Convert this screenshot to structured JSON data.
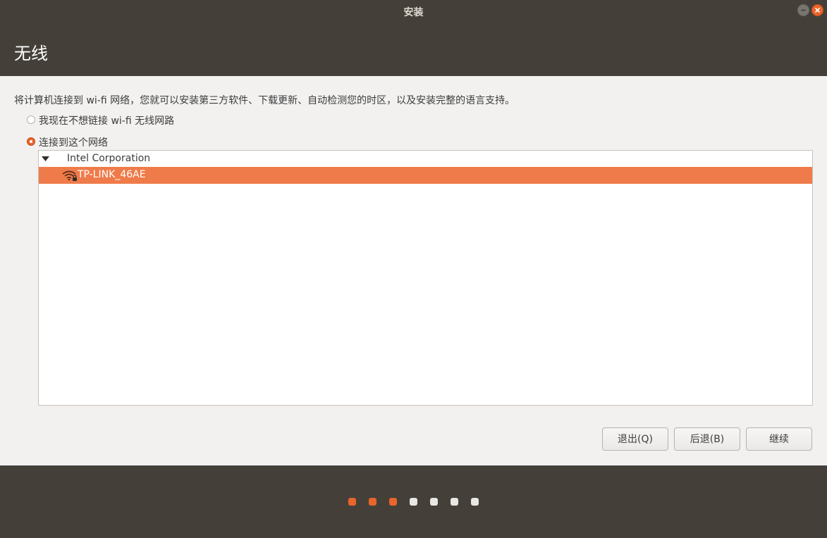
{
  "window": {
    "title": "安装"
  },
  "header": {
    "title": "无线"
  },
  "content": {
    "description": "将计算机连接到 wi-fi 网络，您就可以安装第三方软件、下载更新、自动检测您的时区，以及安装完整的语言支持。",
    "options": [
      {
        "label": "我现在不想链接 wi-fi 无线网路",
        "selected": false
      },
      {
        "label": "连接到这个网络",
        "selected": true
      }
    ],
    "network_list": {
      "device": "Intel Corporation",
      "networks": [
        {
          "ssid": "TP-LINK_46AE",
          "selected": true,
          "secured": true,
          "icon": "wifi-locked-icon"
        }
      ]
    }
  },
  "buttons": {
    "quit": "退出(Q)",
    "back": "后退(B)",
    "continue": "继续"
  },
  "progress": {
    "total_steps": 7,
    "completed_steps": 3
  },
  "colors": {
    "accent": "#e9652b",
    "selection": "#ef7b4a",
    "header_bg": "#444039",
    "content_bg": "#f2f1f0",
    "dot_inactive": "#e8e7e4"
  }
}
